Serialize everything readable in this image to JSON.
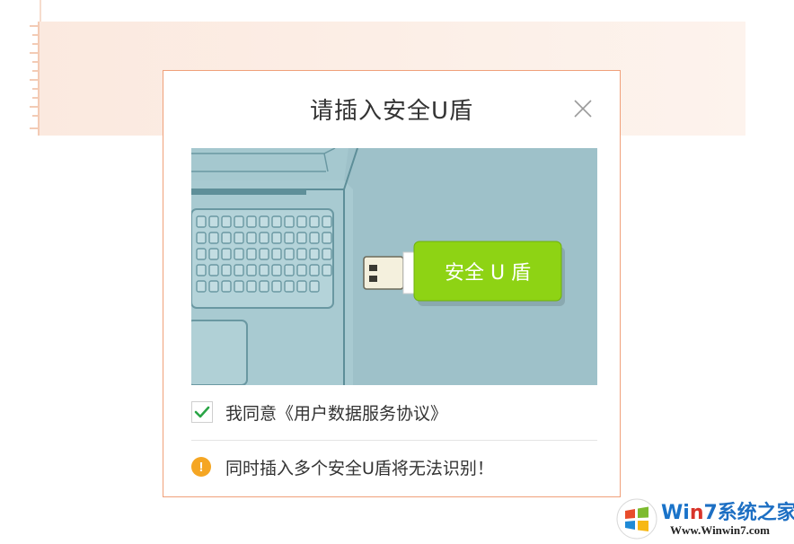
{
  "dialog": {
    "title": "请插入安全U盾",
    "illustration": {
      "usb_key_label": "安全 U 盾"
    },
    "agree": {
      "checked": true,
      "prefix": "我同意",
      "link": "《用户数据服务协议》"
    },
    "warning": {
      "icon_glyph": "!",
      "text": "同时插入多个安全U盾将无法识别！"
    }
  },
  "watermark": {
    "brand_w": "Wi",
    "brand_n": "n",
    "brand_rest": "7系统之家",
    "url": "Www.Winwin7.com"
  },
  "colors": {
    "dialog_border": "#f0a07a",
    "illustration_bg": "#9ec1c9",
    "usb_key_green": "#8ed314",
    "check_green": "#2aa546",
    "warning_orange": "#f5a623",
    "background_band": "#fbe9df"
  },
  "icons": {
    "close": "close-icon",
    "check": "checkmark-icon",
    "warning": "warning-icon",
    "logo": "windows-logo-icon"
  }
}
